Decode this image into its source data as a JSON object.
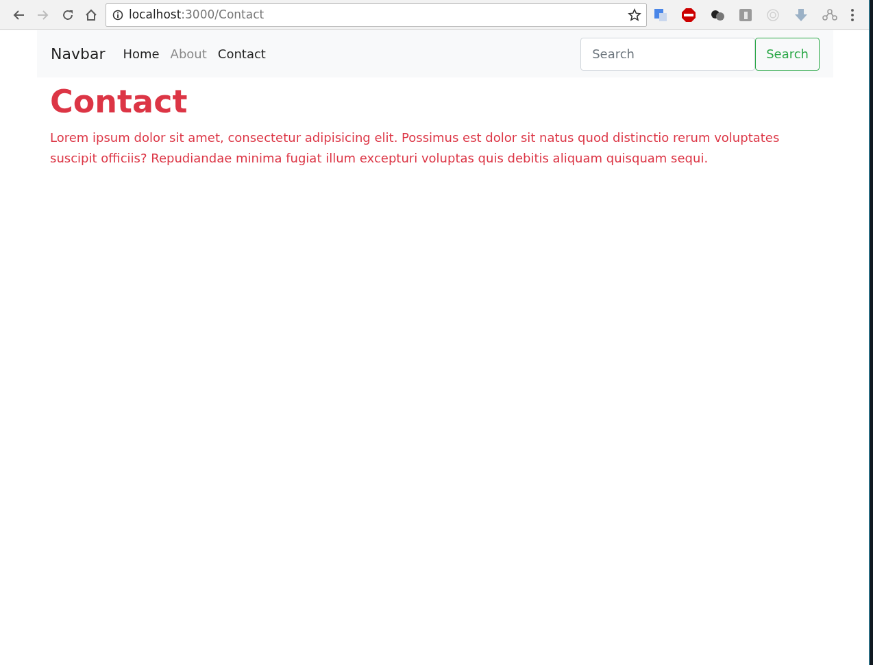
{
  "browser": {
    "url_host": "localhost",
    "url_path": ":3000/Contact"
  },
  "navbar": {
    "brand": "Navbar",
    "links": [
      {
        "label": "Home",
        "disabled": false
      },
      {
        "label": "About",
        "disabled": true
      },
      {
        "label": "Contact",
        "disabled": false
      }
    ],
    "search": {
      "placeholder": "Search",
      "button": "Search"
    }
  },
  "content": {
    "heading": "Contact",
    "paragraph": "Lorem ipsum dolor sit amet, consectetur adipisicing elit. Possimus est dolor sit natus quod distinctio rerum voluptates suscipit officiis? Repudiandae minima fugiat illum excepturi voluptas quis debitis aliquam quisquam sequi."
  }
}
